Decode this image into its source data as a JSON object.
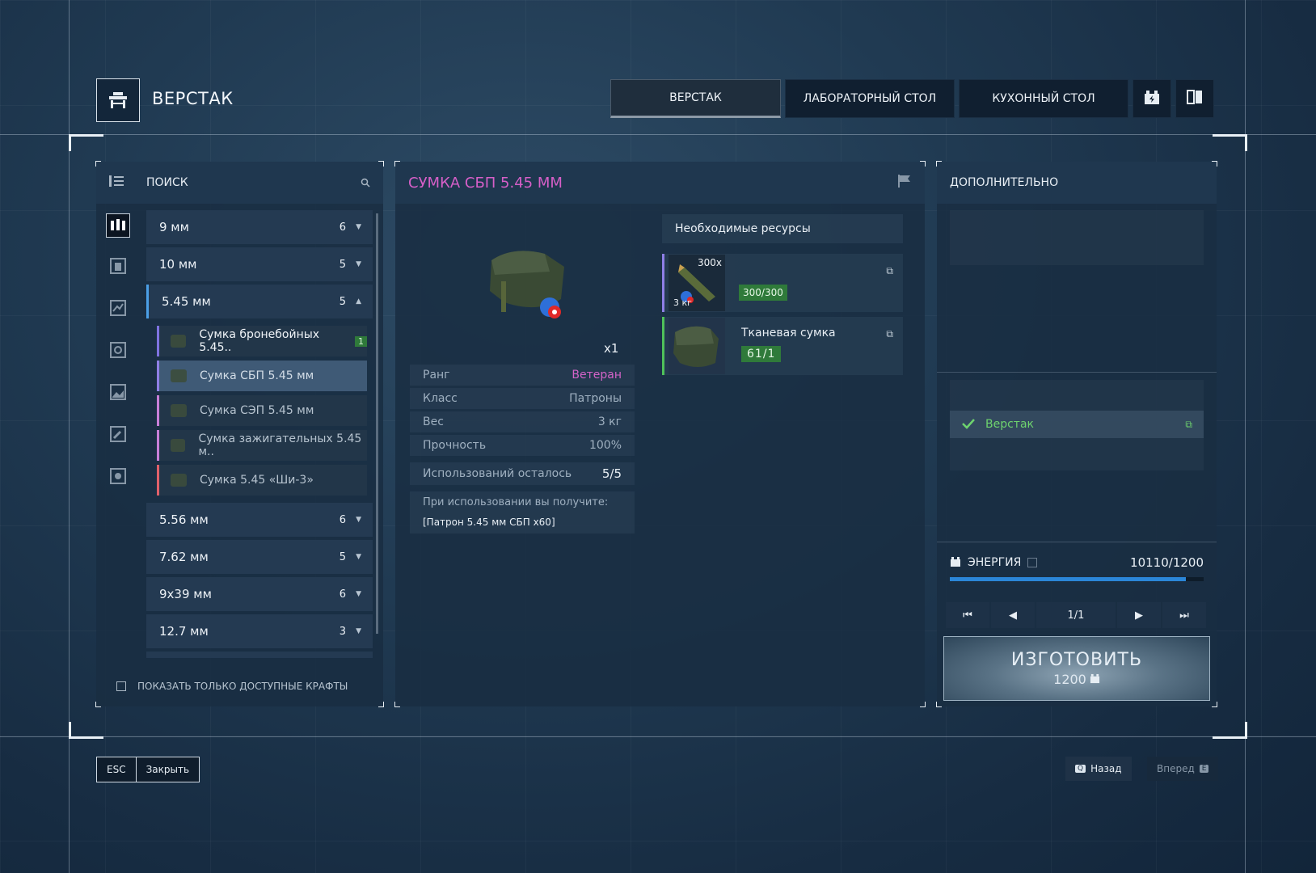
{
  "header": {
    "title": "ВЕРСТАК",
    "tabs": [
      {
        "label": "ВЕРСТАК",
        "active": true
      },
      {
        "label": "ЛАБОРАТОРНЫЙ СТОЛ",
        "active": false
      },
      {
        "label": "КУХОННЫЙ СТОЛ",
        "active": false
      }
    ],
    "icons": [
      "energy-box-icon",
      "book-icon"
    ]
  },
  "left": {
    "search_label": "ПОИСК",
    "groups_top": [
      {
        "label": "9 мм",
        "count": "6"
      },
      {
        "label": "10 мм",
        "count": "5"
      },
      {
        "label": "5.45 мм",
        "count": "5"
      }
    ],
    "subitems": [
      {
        "label": "Сумка бронебойных 5.45..",
        "badge": "1",
        "color": "#7f73e0"
      },
      {
        "label": "Сумка СБП 5.45 мм",
        "color": "#8f7fe6"
      },
      {
        "label": "Сумка СЭП 5.45 мм",
        "color": "#c77fd8"
      },
      {
        "label": "Сумка зажигательных 5.45 м..",
        "color": "#c77fd8"
      },
      {
        "label": "Сумка 5.45 «Ши-3»",
        "color": "#e0606a"
      }
    ],
    "groups_bottom": [
      {
        "label": "5.56 мм",
        "count": "6"
      },
      {
        "label": "7.62 мм",
        "count": "5"
      },
      {
        "label": "9x39 мм",
        "count": "6"
      },
      {
        "label": "12.7 мм",
        "count": "3"
      }
    ],
    "filter_label": "ПОКАЗАТЬ ТОЛЬКО ДОСТУПНЫЕ КРАФТЫ"
  },
  "middle": {
    "title": "СУМКА СБП 5.45 ММ",
    "quantity": "x1",
    "stats": [
      {
        "label": "Ранг",
        "value": "Ветеран"
      },
      {
        "label": "Класс",
        "value": "Патроны"
      },
      {
        "label": "Вес",
        "value": "3 кг"
      },
      {
        "label": "Прочность",
        "value": "100%"
      }
    ],
    "uses_label": "Использований осталось",
    "uses_value": "5/5",
    "receive_label": "При использовании вы получите:",
    "receive_value": "[Патрон 5.45 мм СБП x60]",
    "resources_title": "Необходимые ресурсы",
    "resources": [
      {
        "qty": "300x",
        "weight": "3 кг",
        "progress": "300/300",
        "name": ""
      },
      {
        "name": "Тканевая сумка",
        "progress": "61/1"
      }
    ]
  },
  "right": {
    "title": "ДОПОЛНИТЕЛЬНО",
    "station": "Верстак",
    "energy_label": "ЭНЕРГИЯ",
    "energy_value": "10110/1200",
    "energy_fill": 0.93,
    "page": "1/1",
    "craft_label": "ИЗГОТОВИТЬ",
    "craft_cost": "1200"
  },
  "footer": {
    "esc_key": "ESC",
    "close_label": "Закрыть",
    "back_key": "Q",
    "back_label": "Назад",
    "forward_label": "Вперед",
    "forward_key": "E"
  },
  "colors": {
    "accent_pink": "#d65fc8",
    "rank_color": "#d463c8",
    "progress_green": "#2f7a3a",
    "energy_blue": "#2b86d8"
  }
}
